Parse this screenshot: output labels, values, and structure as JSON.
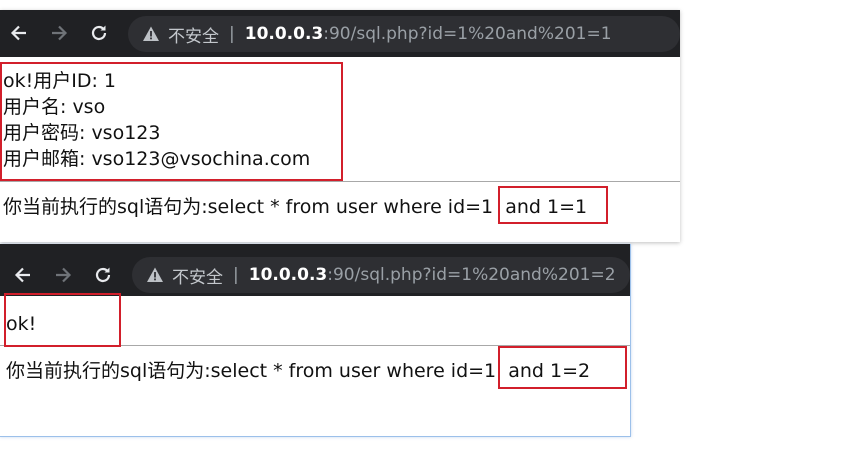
{
  "browser": {
    "insecure_label": "不安全",
    "separator": "|",
    "host": "10.0.0.3",
    "rest": ":90/sql.php?id=1%20and%201=1",
    "icons": [
      "back-arrow-icon",
      "forward-arrow-icon",
      "reload-icon",
      "warning-triangle-icon"
    ]
  },
  "browser2": {
    "insecure_label": "不安全",
    "separator": "|",
    "host": "10.0.0.3",
    "rest": ":90/sql.php?id=1%20and%201=2"
  },
  "page1": {
    "lines": [
      "ok!用户ID: 1",
      "用户名: vso",
      "用户密码: vso123",
      "用户邮箱: vso123@vsochina.com"
    ],
    "sql_prefix": "你当前执行的sql语句为:select * from user where id=1",
    "sql_suffix": "and 1=1"
  },
  "page2": {
    "result": "ok!",
    "sql_prefix": "你当前执行的sql语句为:select * from user where id=1",
    "sql_suffix": "and 1=2"
  },
  "colors": {
    "toolbar": "#202124",
    "omnibox": "#2e2f33",
    "highlight_red": "#d21f2b"
  }
}
